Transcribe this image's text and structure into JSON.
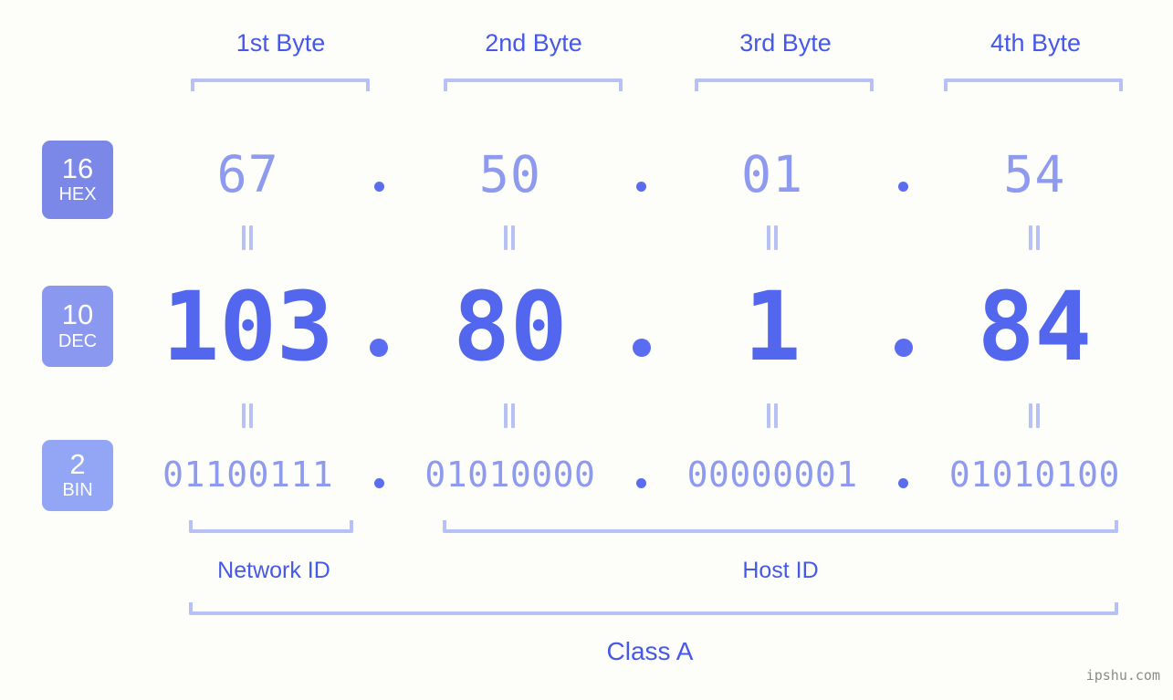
{
  "background_color": "#fdfefa",
  "colors": {
    "label_blue": "#4558e8",
    "bracket_blue": "#b7c1f6",
    "hex_value": "#8e9aee",
    "dec_value": "#5267ee",
    "bin_value": "#8e9aee",
    "badge_hex": "#7b88e8",
    "badge_dec": "#8b98f0",
    "badge_bin": "#92a6f5",
    "watermark": "#8a8a8a"
  },
  "byte_headers": [
    {
      "label": "1st Byte"
    },
    {
      "label": "2nd Byte"
    },
    {
      "label": "3rd Byte"
    },
    {
      "label": "4th Byte"
    }
  ],
  "bases": [
    {
      "number": "16",
      "name": "HEX"
    },
    {
      "number": "10",
      "name": "DEC"
    },
    {
      "number": "2",
      "name": "BIN"
    }
  ],
  "separator": ".",
  "equals_symbol": "=",
  "rows": {
    "hex": {
      "base_number": "16",
      "base_name": "HEX",
      "values": [
        "67",
        "50",
        "01",
        "54"
      ]
    },
    "dec": {
      "base_number": "10",
      "base_name": "DEC",
      "values": [
        "103",
        "80",
        "1",
        "84"
      ]
    },
    "bin": {
      "base_number": "2",
      "base_name": "BIN",
      "values": [
        "01100111",
        "01010000",
        "00000001",
        "01010100"
      ]
    }
  },
  "sections": {
    "network_id": "Network ID",
    "host_id": "Host ID",
    "class": "Class A"
  },
  "watermark": "ipshu.com"
}
